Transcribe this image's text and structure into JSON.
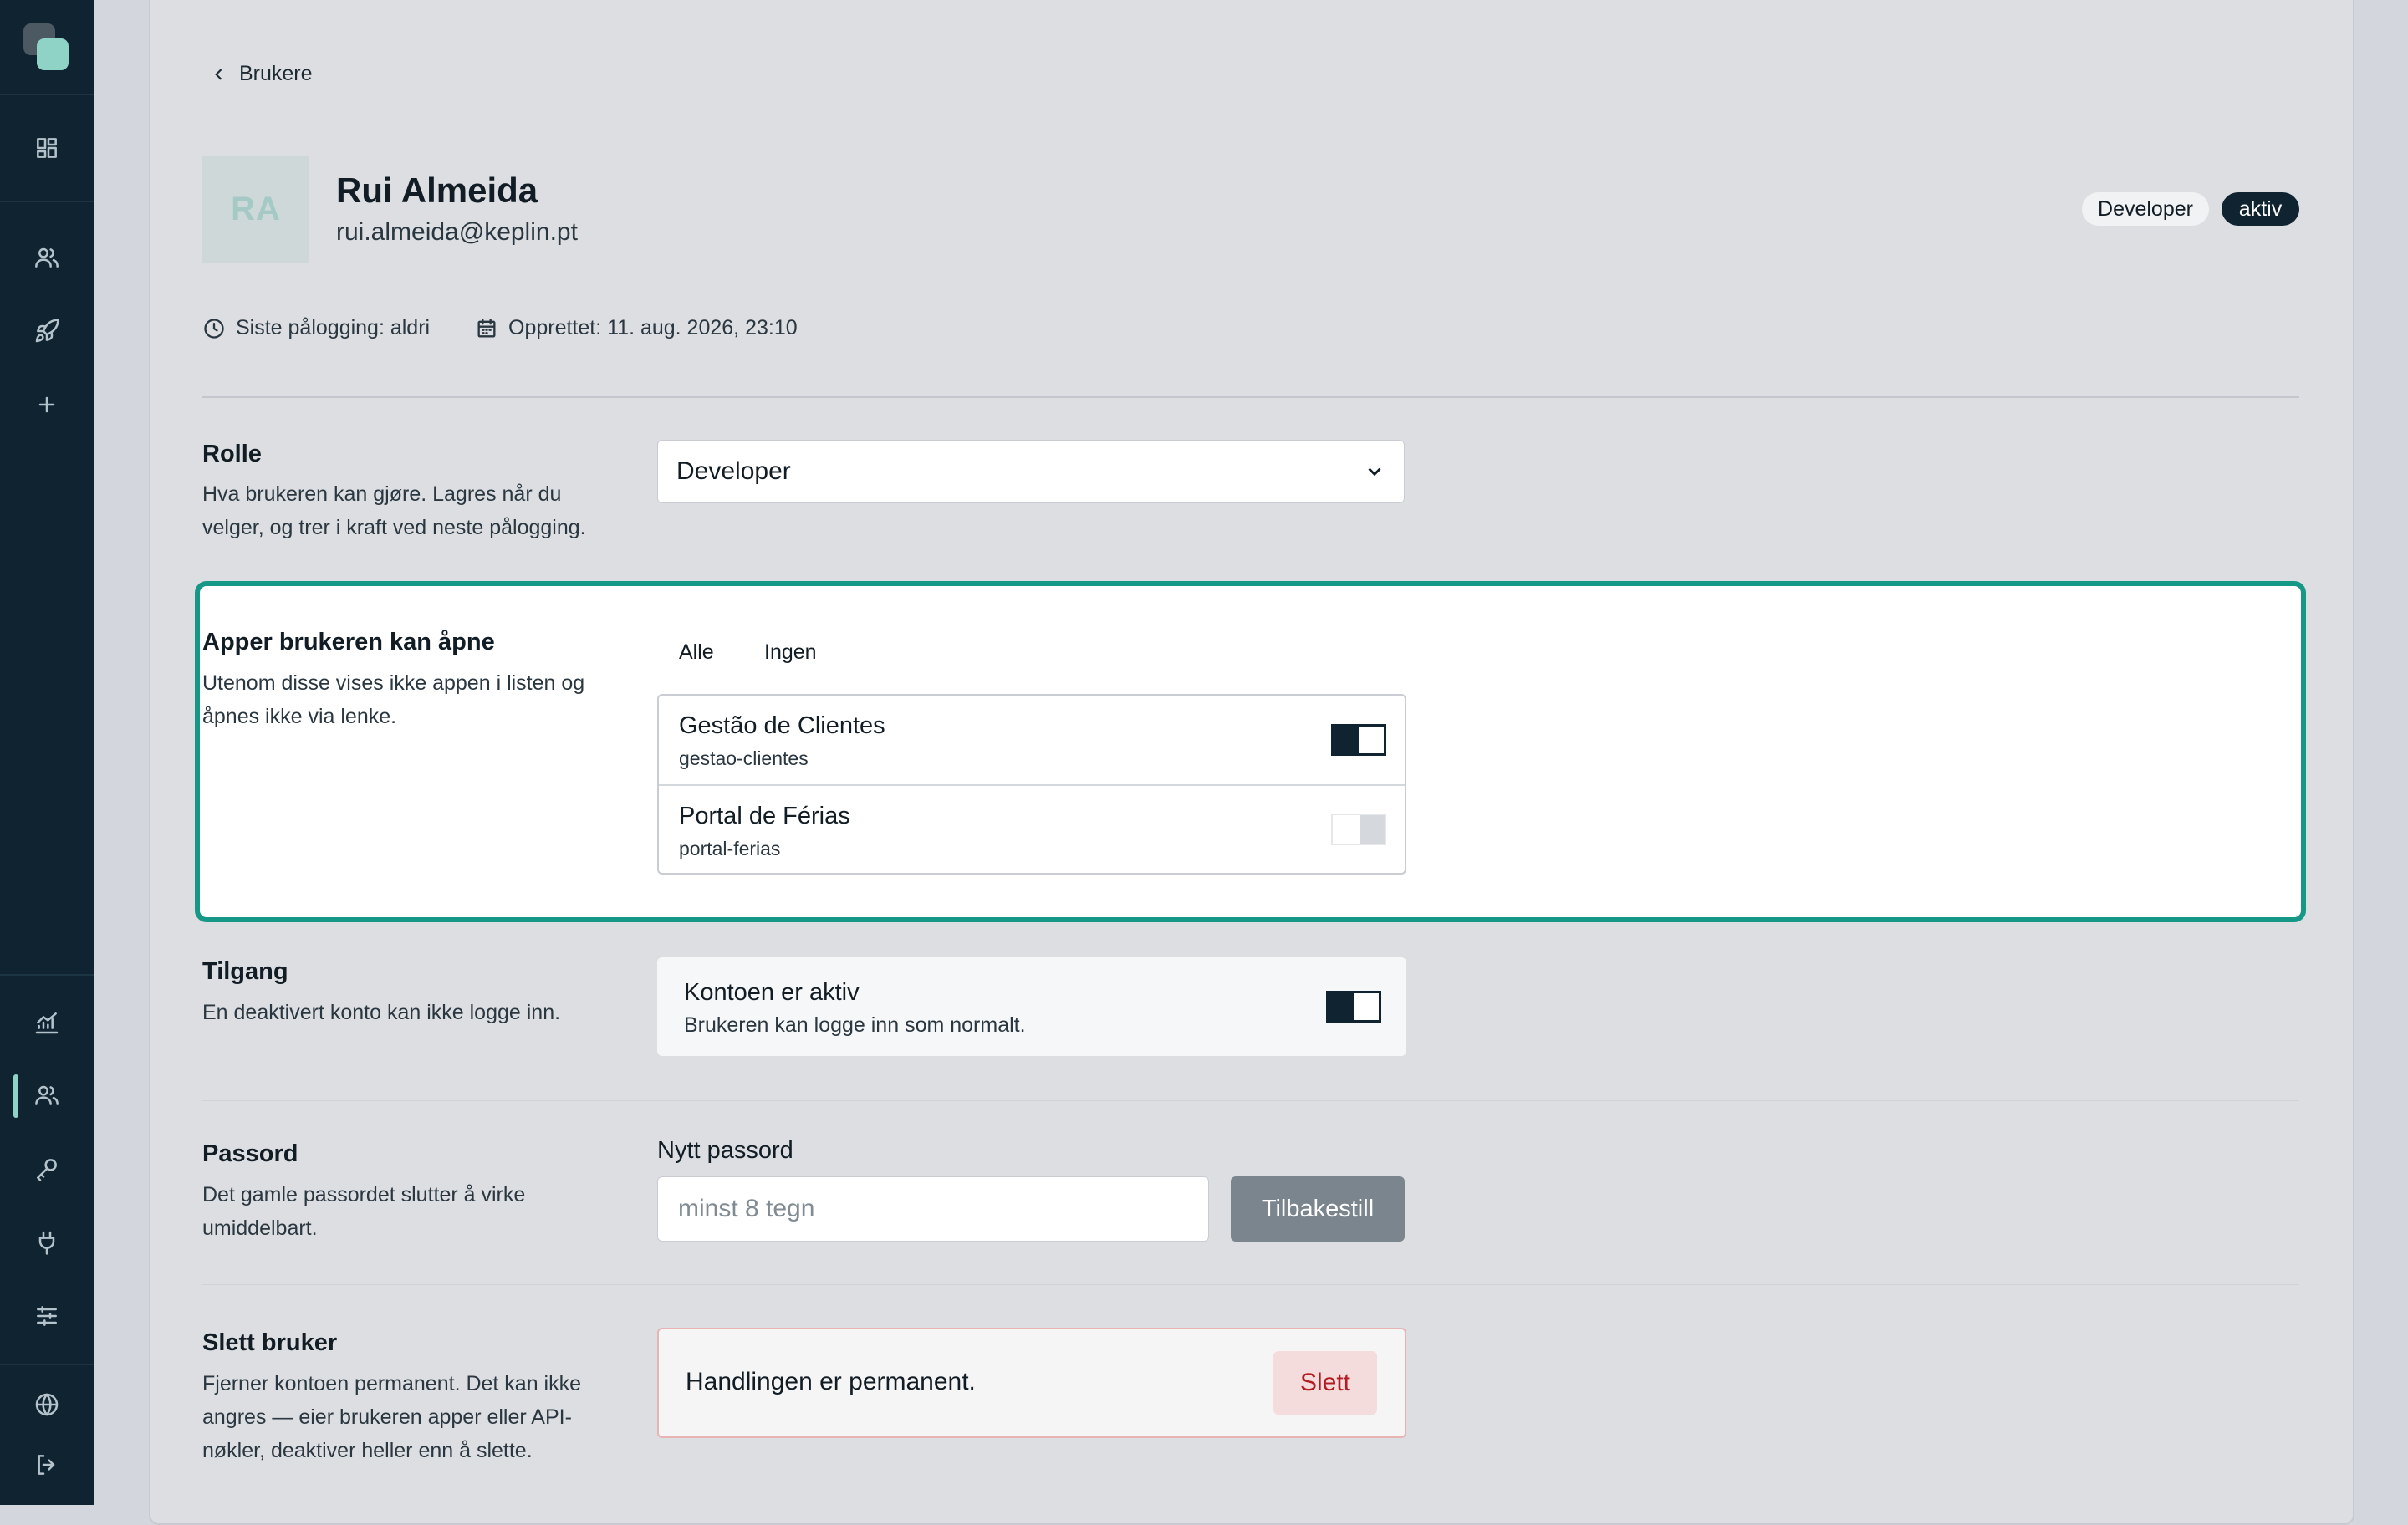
{
  "nav": {
    "items": [
      "dashboard-icon",
      "users-icon",
      "rocket-icon",
      "plus-icon",
      "analytics-icon",
      "users-icon",
      "key-icon",
      "plug-icon",
      "sliders-icon",
      "globe-icon",
      "logout-icon"
    ],
    "active": "users"
  },
  "breadcrumb": {
    "back_label": "Brukere"
  },
  "user": {
    "initials": "RA",
    "name": "Rui Almeida",
    "email": "rui.almeida@keplin.pt",
    "role_badge": "Developer",
    "status_badge": "aktiv",
    "last_login": "Siste pålogging: aldri",
    "created": "Opprettet: 11. aug. 2026, 23:10"
  },
  "role_section": {
    "title": "Rolle",
    "description": "Hva brukeren kan gjøre. Lagres når du velger, og trer i kraft ved neste pålogging.",
    "selected": "Developer"
  },
  "apps_section": {
    "title": "Apper brukeren kan åpne",
    "description": "Utenom disse vises ikke appen i listen og åpnes ikke via lenke.",
    "all_label": "Alle",
    "none_label": "Ingen",
    "apps": [
      {
        "name": "Gestão de Clientes",
        "slug": "gestao-clientes",
        "enabled": true
      },
      {
        "name": "Portal de Férias",
        "slug": "portal-ferias",
        "enabled": false
      }
    ]
  },
  "access_section": {
    "title": "Tilgang",
    "description": "En deaktivert konto kan ikke logge inn.",
    "card_title": "Kontoen er aktiv",
    "card_desc": "Brukeren kan logge inn som normalt.",
    "active": true
  },
  "password_section": {
    "title": "Passord",
    "description": "Det gamle passordet slutter å virke umiddelbart.",
    "label": "Nytt passord",
    "placeholder": "minst 8 tegn",
    "reset_label": "Tilbakestill"
  },
  "delete_section": {
    "title": "Slett bruker",
    "description": "Fjerner kontoen permanent. Det kan ikke angres — eier brukeren apper eller API-nøkler, deaktiver heller enn å slette.",
    "notice": "Handlingen er permanent.",
    "delete_label": "Slett"
  },
  "colors": {
    "sidebar": "#0f2330",
    "accent": "#169886",
    "danger": "#b21d22"
  }
}
